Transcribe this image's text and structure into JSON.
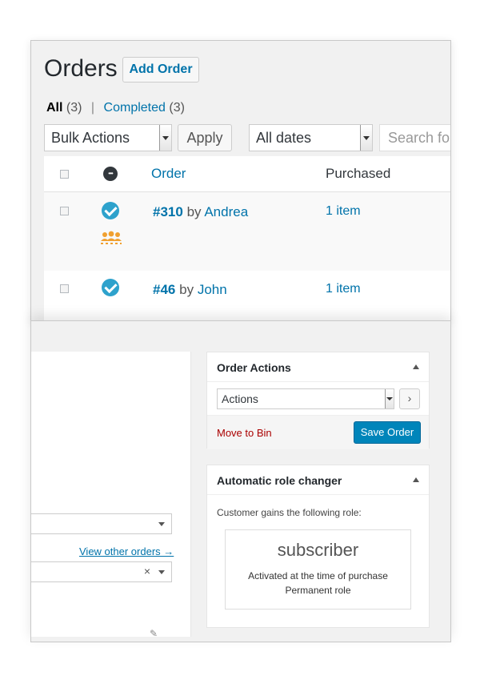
{
  "orders_page": {
    "title": "Orders",
    "add_button": "Add Order",
    "filters": {
      "all_label": "All",
      "all_count": "(3)",
      "separator": "|",
      "completed_label": "Completed",
      "completed_count": "(3)"
    },
    "bulk_actions": "Bulk Actions",
    "apply_button": "Apply",
    "date_filter": "All dates",
    "search_placeholder": "Search fo",
    "columns": {
      "order": "Order",
      "purchased": "Purchased"
    },
    "rows": [
      {
        "number": "#310",
        "by": "by",
        "customer": "Andrea",
        "purchased": "1 item"
      },
      {
        "number": "#46",
        "by": "by",
        "customer": "John",
        "purchased": "1 item"
      }
    ],
    "colors": {
      "link": "#0073aa",
      "status_check": "#2ea2cc",
      "group_icon": "#f0a030"
    }
  },
  "edit_order": {
    "view_other_orders": "View other orders →",
    "order_actions": {
      "title": "Order Actions",
      "select_value": "Actions",
      "go_symbol": "›",
      "move_to_bin": "Move to Bin",
      "save_button": "Save Order"
    },
    "role_changer": {
      "title": "Automatic role changer",
      "label": "Customer gains the following role:",
      "role": "subscriber",
      "line1": "Activated at the time of purchase",
      "line2": "Permanent role"
    },
    "colors": {
      "primary_button": "#0085ba",
      "danger": "#aa0000"
    }
  }
}
